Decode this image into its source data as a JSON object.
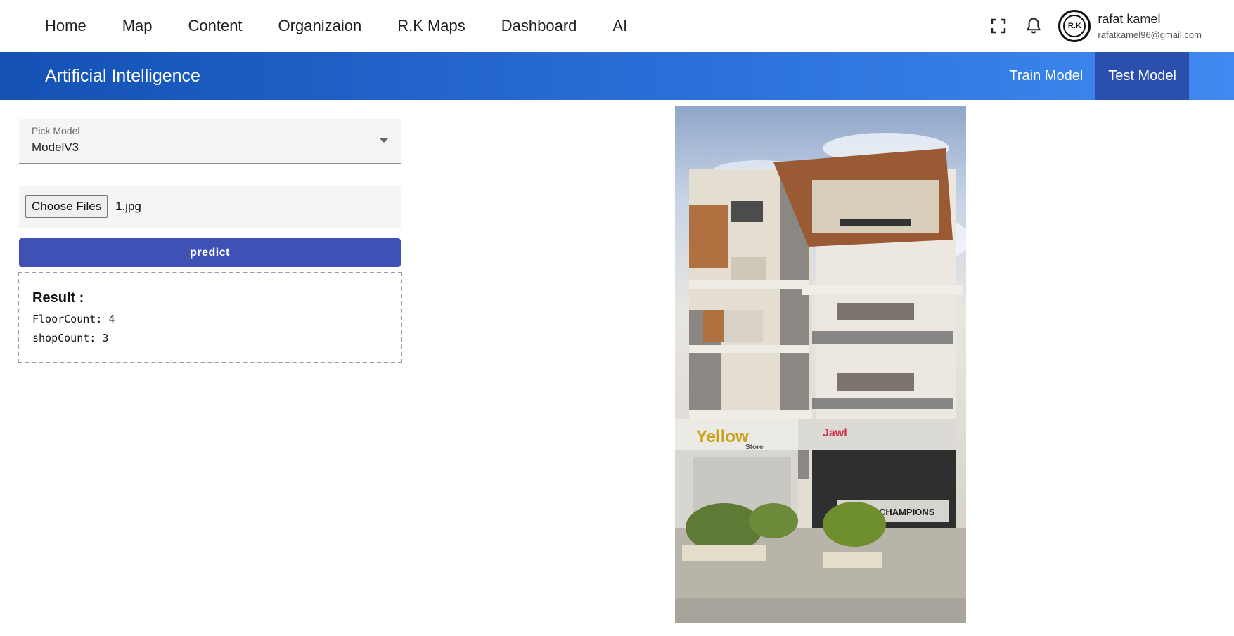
{
  "nav": {
    "items": [
      {
        "label": "Home"
      },
      {
        "label": "Map"
      },
      {
        "label": "Content"
      },
      {
        "label": "Organizaion"
      },
      {
        "label": "R.K Maps"
      },
      {
        "label": "Dashboard"
      },
      {
        "label": "AI"
      }
    ]
  },
  "user": {
    "avatar_text": "R.K",
    "name": "rafat kamel",
    "email": "rafatkamel96@gmail.com"
  },
  "icons": {
    "fullscreen": "fullscreen-icon",
    "notifications": "bell-icon",
    "dropdown": "caret-down-icon"
  },
  "banner": {
    "title": "Artificial Intelligence",
    "tabs": [
      {
        "label": "Train Model",
        "active": false
      },
      {
        "label": "Test Model",
        "active": true
      }
    ]
  },
  "form": {
    "model_label": "Pick Model",
    "model_value": "ModelV3",
    "choose_files_label": "Choose Files",
    "file_name": "1.jpg",
    "predict_label": "predict"
  },
  "result": {
    "title": "Result :",
    "lines": [
      "FloorCount: 4",
      "shopCount: 3"
    ]
  },
  "photo": {
    "signs": [
      "Yellow",
      "Store",
      "CHAMPIONS"
    ]
  },
  "colors": {
    "banner_start": "#1451b3",
    "banner_end": "#3f8af0",
    "active_tab": "#2a4fad",
    "predict_button": "#3f51b5"
  }
}
